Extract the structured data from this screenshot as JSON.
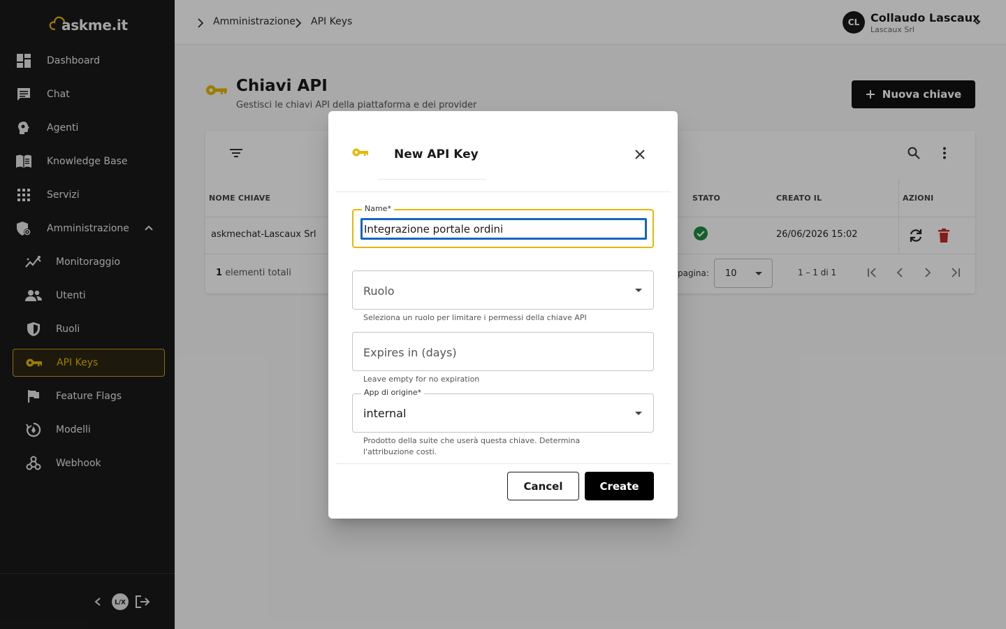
{
  "app": {
    "logo_text": "askme.it"
  },
  "sidebar": {
    "items": [
      {
        "label": "Dashboard",
        "icon": "dashboard-icon"
      },
      {
        "label": "Chat",
        "icon": "chat-icon"
      },
      {
        "label": "Agenti",
        "icon": "agent-head-icon"
      },
      {
        "label": "Knowledge Base",
        "icon": "book-icon"
      },
      {
        "label": "Servizi",
        "icon": "apps-grid-icon"
      },
      {
        "label": "Amministrazione",
        "icon": "admin-shield-icon",
        "expanded": true
      }
    ],
    "sub_items": [
      {
        "label": "Monitoraggio",
        "icon": "monitoring-icon"
      },
      {
        "label": "Utenti",
        "icon": "users-icon"
      },
      {
        "label": "Ruoli",
        "icon": "shield-icon"
      },
      {
        "label": "API Keys",
        "icon": "key-icon",
        "active": true
      },
      {
        "label": "Feature Flags",
        "icon": "flag-icon"
      },
      {
        "label": "Modelli",
        "icon": "model-icon"
      },
      {
        "label": "Webhook",
        "icon": "webhook-icon"
      }
    ],
    "footer_badge": "L/X"
  },
  "topbar": {
    "breadcrumb": [
      "Amministrazione",
      "API Keys"
    ],
    "user": {
      "initials": "CL",
      "name": "Collaudo Lascaux",
      "org": "Lascaux Srl"
    }
  },
  "page": {
    "title": "Chiavi API",
    "subtitle": "Gestisci le chiavi API della piattaforma e dei provider",
    "new_button": "Nuova chiave"
  },
  "table": {
    "columns": [
      "NOME CHIAVE",
      "STATO",
      "CREATO IL",
      "AZIONI"
    ],
    "rows": [
      {
        "name": "askmechat-Lascaux Srl",
        "status": "active",
        "created": "26/06/2026 15:02"
      }
    ],
    "total_count": "1",
    "total_label": "elementi totali",
    "per_page_label": "pagina:",
    "per_page": "10",
    "range": "1 – 1 di 1"
  },
  "dialog": {
    "title": "New API Key",
    "name_label": "Name*",
    "name_value": "Integrazione portale ordini",
    "role_placeholder": "Ruolo",
    "role_hint": "Seleziona un ruolo per limitare i permessi della chiave API",
    "expires_placeholder": "Expires in (days)",
    "expires_hint": "Leave empty for no expiration",
    "origin_label": "App di origine*",
    "origin_value": "internal",
    "origin_hint": "Prodotto della suite che userà questa chiave. Determina l'attribuzione costi.",
    "cancel": "Cancel",
    "create": "Create"
  },
  "colors": {
    "accent": "#e6b800",
    "sidebar_bg": "#1a1a1a",
    "success": "#1e8e3e",
    "danger": "#c62828",
    "focus_ring": "#1565c0"
  }
}
